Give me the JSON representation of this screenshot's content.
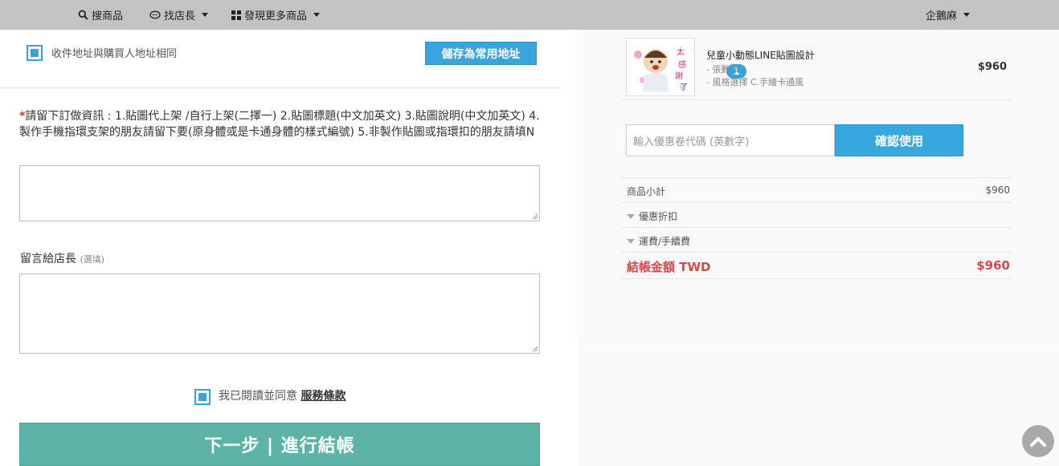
{
  "nav": {
    "search_label": "搜商品",
    "find_shop_label": "找店長",
    "discover_label": "發現更多商品",
    "user_label": "企鵝麻"
  },
  "address": {
    "same_as_buyer_label": "收件地址與購買人地址相同",
    "same_as_buyer_checked": true,
    "save_button_label": "儲存為常用地址"
  },
  "order_note": {
    "required_mark": "*",
    "prompt": "請留下訂做資訊 : 1.貼圖代上架 /自行上架(二擇一) 2.貼圖標題(中文加英文) 3.貼圖說明(中文加英文) 4.製作手機指環支架的朋友請留下要(原身體或是卡通身體的樣式編號) 5.非製作貼圖或指環扣的朋友請填N",
    "value": ""
  },
  "message": {
    "label": "留言給店長",
    "optional_tag": "(選填)",
    "value": ""
  },
  "terms": {
    "checked": true,
    "text": "我已閱讀並同意",
    "link_label": "服務條款"
  },
  "next_button_label": "下一步 | 進行結帳",
  "cart": {
    "item": {
      "quantity": "1",
      "name": "兒童小動態LINE貼圖設計",
      "spec_1": "- 張數 8",
      "spec_2": "- 風格選擇 C.手繪卡通風",
      "price": "$960",
      "thumb_text": "太感謝了"
    },
    "coupon": {
      "placeholder": "輸入優惠卷代碼 (英數字)",
      "button_label": "確認使用"
    },
    "summary": {
      "subtotal_label": "商品小計",
      "subtotal_value": "$960",
      "discount_label": "優惠折扣",
      "shipping_label": "運費/手續費",
      "total_label": "結帳金額 TWD",
      "total_value": "$960"
    }
  },
  "colors": {
    "accent_blue": "#39a5dc",
    "next_button": "#5db4a6",
    "total_red": "#d24a4a",
    "topbar": "#c3c3c3"
  }
}
